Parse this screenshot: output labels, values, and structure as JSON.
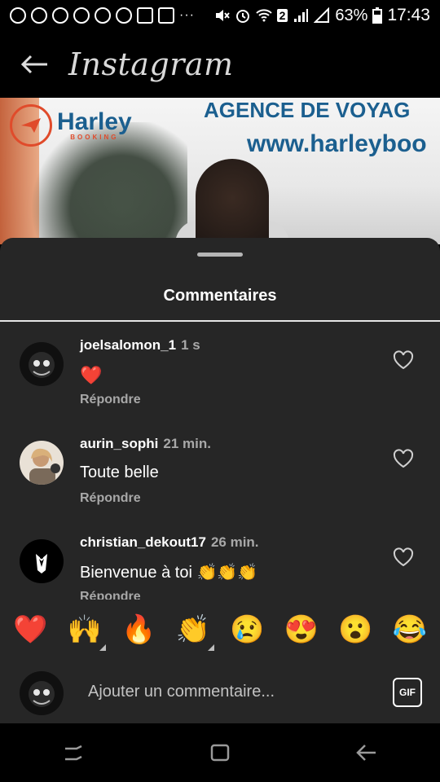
{
  "status": {
    "battery": "63%",
    "time": "17:43",
    "sim_badge": "2"
  },
  "header": {
    "title": "Instagram"
  },
  "banner": {
    "brand": "Harley",
    "brand_sub": "BOOKING",
    "tagline": "AGENCE DE VOYAG",
    "url": "www.harleyboo"
  },
  "sheet": {
    "title": "Commentaires"
  },
  "comments": [
    {
      "username": "joelsalomon_1",
      "time": "1 s",
      "text": "❤️",
      "reply": "Répondre"
    },
    {
      "username": "aurin_sophi",
      "time": "21 min.",
      "text": "Toute belle",
      "reply": "Répondre"
    },
    {
      "username": "christian_dekout17",
      "time": "26 min.",
      "text": "Bienvenue à toi 👏👏👏",
      "reply": "Répondre"
    }
  ],
  "emoji_bar": [
    "❤️",
    "🙌",
    "🔥",
    "👏",
    "😢",
    "😍",
    "😮",
    "😂"
  ],
  "input": {
    "placeholder": "Ajouter un commentaire...",
    "gif_label": "GIF"
  },
  "colors": {
    "sheet_bg": "#262626",
    "secondary_text": "#a8a8a8",
    "brand_blue": "#1b5f8f",
    "brand_red": "#e04b2b"
  }
}
